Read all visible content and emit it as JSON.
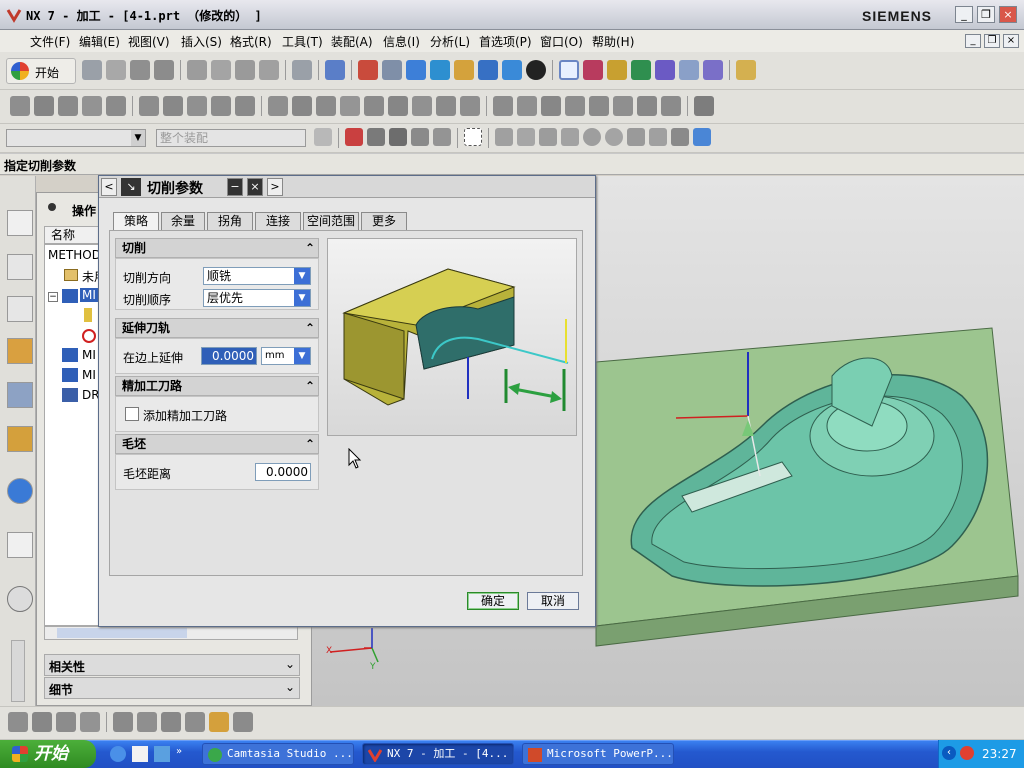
{
  "window": {
    "title": "NX 7 - 加工 - [4-1.prt （修改的） ]",
    "brand": "SIEMENS",
    "controls": [
      "_",
      "❐",
      "×"
    ]
  },
  "menu": [
    "文件(F)",
    "编辑(E)",
    "视图(V)",
    "插入(S)",
    "格式(R)",
    "工具(T)",
    "装配(A)",
    "信息(I)",
    "分析(L)",
    "首选项(P)",
    "窗口(O)",
    "帮助(H)"
  ],
  "toolbar": {
    "start_label": "开始",
    "assembly_placeholder": "整个装配"
  },
  "status_prompt": "指定切削参数",
  "nav": {
    "title": "操作",
    "column_header": "名称",
    "items": [
      "METHOD",
      "未用",
      "MI",
      "MI",
      "MI",
      "DR"
    ],
    "sections": [
      "相关性",
      "细节"
    ]
  },
  "dialog": {
    "title": "切削参数",
    "tabs": [
      "策略",
      "余量",
      "拐角",
      "连接",
      "空间范围",
      "更多"
    ],
    "active_tab": "策略",
    "groups": {
      "cutting": {
        "header": "切削",
        "direction_label": "切削方向",
        "direction_value": "顺铣",
        "order_label": "切削顺序",
        "order_value": "层优先"
      },
      "extend": {
        "header": "延伸刀轨",
        "edge_label": "在边上延伸",
        "edge_value": "0.0000",
        "unit": "mm"
      },
      "finish": {
        "header": "精加工刀路",
        "checkbox_label": "添加精加工刀路"
      },
      "blank": {
        "header": "毛坯",
        "distance_label": "毛坯距离",
        "distance_value": "0.0000"
      }
    },
    "ok_label": "确定",
    "cancel_label": "取消"
  },
  "taskbar": {
    "start": "开始",
    "tasks": [
      "Camtasia Studio ...",
      "NX 7 - 加工 - [4...",
      "Microsoft PowerP..."
    ],
    "clock": "23:27"
  },
  "colors": {
    "title_gradient": "#c4c8d2",
    "dialog_border": "#5c6d8a",
    "part_green": "#8fbc88",
    "model_teal": "#5fb59a",
    "taskbar_blue": "#2459cf"
  }
}
